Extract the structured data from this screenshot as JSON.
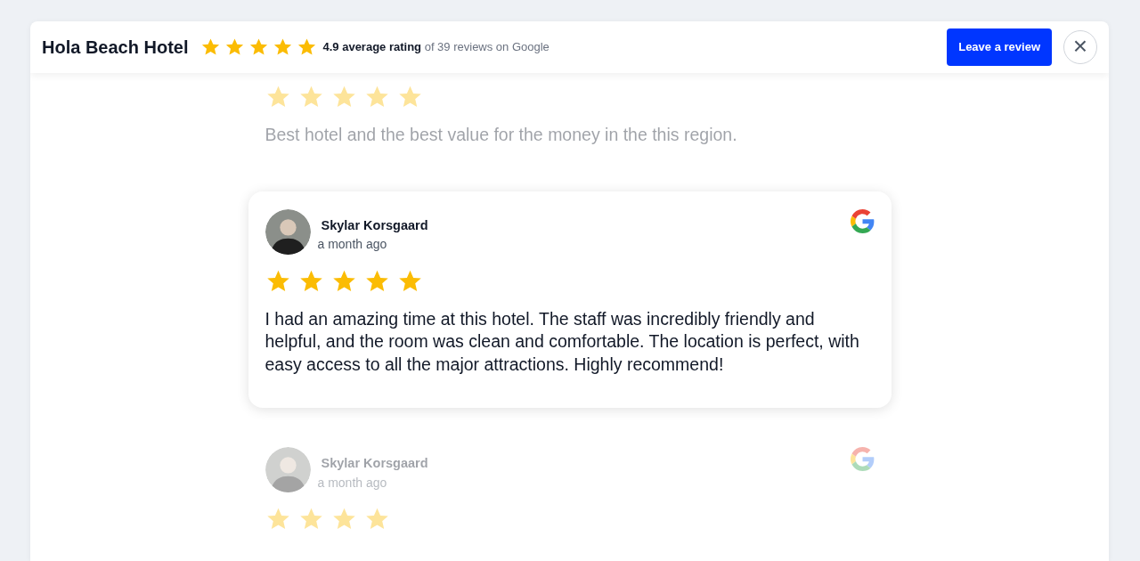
{
  "header": {
    "title": "Hola Beach Hotel",
    "stars": 5,
    "rating": "**4.9 average rating** of 39 reviews on Google",
    "review_button": "Leave a review",
    "close_button": "×"
  },
  "reviews": [
    {
      "focused": false,
      "kind": "partial",
      "stars": 5,
      "text": "Best hotel and the best value for the money in the this region."
    },
    {
      "focused": true,
      "kind": "full",
      "name": "Skylar Korsgaard",
      "time": "a month ago",
      "stars": 5,
      "text": "I had an amazing time at this hotel. The staff was incredibly friendly and helpful, and the room was clean and comfortable. The location is perfect, with easy access to all the major attractions. Highly recommend!"
    },
    {
      "focused": false,
      "kind": "full",
      "name": "Skylar Korsgaard",
      "time": "a month ago",
      "stars": 4
    }
  ]
}
